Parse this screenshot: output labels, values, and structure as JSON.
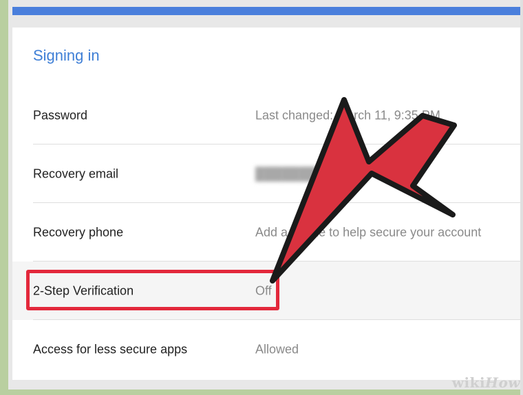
{
  "section": {
    "title": "Signing in"
  },
  "rows": [
    {
      "label": "Password",
      "value": "Last changed: March 11, 9:35 PM"
    },
    {
      "label": "Recovery email",
      "value": "████████████"
    },
    {
      "label": "Recovery phone",
      "value": "Add a phone to help secure your account"
    },
    {
      "label": "2-Step Verification",
      "value": "Off"
    },
    {
      "label": "Access for less secure apps",
      "value": "Allowed"
    }
  ],
  "watermark": {
    "wiki": "wiki",
    "how": "How"
  },
  "colors": {
    "accent": "#3f7fd6",
    "topbar": "#4a7fdc",
    "highlight": "#e3283b"
  },
  "icons": {
    "arrow": "red-pointer-arrow-icon"
  }
}
